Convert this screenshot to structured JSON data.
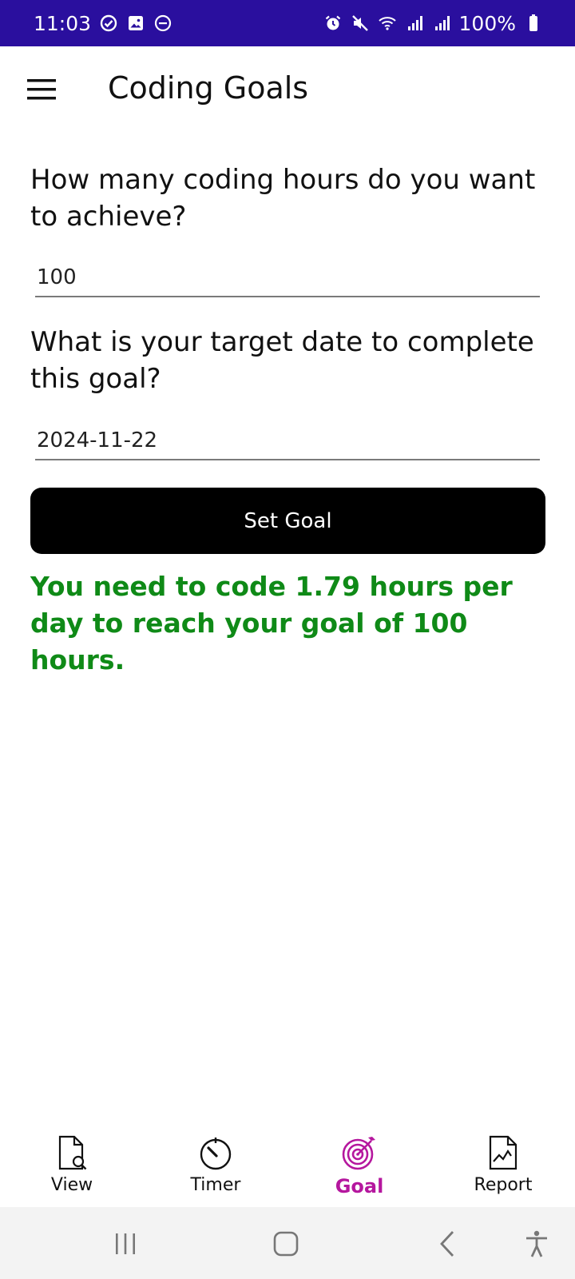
{
  "status_bar": {
    "time": "11:03",
    "battery": "100%",
    "left_icons": [
      "check-circle-icon",
      "gallery-icon",
      "do-not-disturb-icon"
    ],
    "right_icons": [
      "alarm-icon",
      "mute-icon",
      "wifi-icon",
      "signal-icon",
      "signal-icon",
      "battery-icon"
    ]
  },
  "app_bar": {
    "title": "Coding Goals",
    "menu_icon": "hamburger-menu-icon"
  },
  "form": {
    "hours_question": "How many coding hours do you want to achieve?",
    "hours_value": "100",
    "date_question": "What is your target date to complete this goal?",
    "date_value": "2024-11-22",
    "submit_label": "Set Goal"
  },
  "result": {
    "message": "You need to code 1.79 hours per day to reach your goal of 100 hours.",
    "color": "#0f8a17"
  },
  "bottom_nav": {
    "items": [
      {
        "label": "View",
        "icon": "document-search-icon",
        "active": false
      },
      {
        "label": "Timer",
        "icon": "timer-icon",
        "active": false
      },
      {
        "label": "Goal",
        "icon": "target-icon",
        "active": true
      },
      {
        "label": "Report",
        "icon": "report-chart-icon",
        "active": false
      }
    ],
    "active_color": "#b5179e"
  },
  "colors": {
    "status_bar": "#2a0f9e",
    "button": "#000000"
  }
}
